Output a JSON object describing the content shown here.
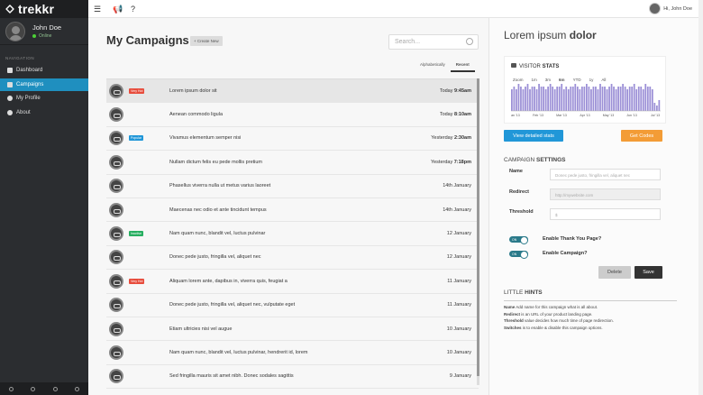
{
  "sidebar": {
    "logo": "trekkr",
    "user": {
      "name": "John Doe",
      "status": "Online"
    },
    "nav_label": "NAVIGATION",
    "items": [
      {
        "label": "Dashboard",
        "icon": "home-icon"
      },
      {
        "label": "Campaigns",
        "icon": "megaphone-icon"
      },
      {
        "label": "My Profile",
        "icon": "user-icon"
      },
      {
        "label": "About",
        "icon": "info-icon"
      }
    ]
  },
  "topbar": {
    "greeting": "Hi, John Doe"
  },
  "main": {
    "title": "My Campaigns",
    "create_label": "+ Create New",
    "search_placeholder": "Search...",
    "tabs": [
      "Alphabetically",
      "Recent"
    ],
    "campaigns": [
      {
        "name": "Lorem ipsum dolor sit",
        "badge": "Very Hot",
        "badge_color": "#e74c3c",
        "day": "Today",
        "time": "9:45am",
        "selected": true
      },
      {
        "name": "Aenean commodo ligula",
        "badge": "",
        "day": "Today",
        "time": "8:10am"
      },
      {
        "name": "Vivamus elementum semper nisi",
        "badge": "Popular",
        "badge_color": "#2197d8",
        "day": "Yesterday",
        "time": "2:30am"
      },
      {
        "name": "Nullam dictum felis eu pede mollis pretium",
        "badge": "",
        "day": "Yesterday",
        "time": "7:18pm"
      },
      {
        "name": "Phasellus viverra nulla ut metus varius laoreet",
        "badge": "",
        "day": "14th January",
        "time": ""
      },
      {
        "name": "Maecenas nec odio et ante tincidunt tempus",
        "badge": "",
        "day": "14th January",
        "time": ""
      },
      {
        "name": "Nam quam nunc, blandit vel, luctus pulvinar",
        "badge": "Inactive",
        "badge_color": "#27ae60",
        "day": "12 January",
        "time": ""
      },
      {
        "name": "Donec pede justo, fringilla vel, aliquet nec",
        "badge": "",
        "day": "12 January",
        "time": ""
      },
      {
        "name": "Aliquam lorem ante, dapibus in, viverra quis, feugiat a",
        "badge": "Very Hot",
        "badge_color": "#e74c3c",
        "day": "11 January",
        "time": ""
      },
      {
        "name": "Donec pede justo, fringilla vel, aliquet nec, vulputate eget",
        "badge": "",
        "day": "11 January",
        "time": ""
      },
      {
        "name": "Etiam ultricies nisi vel augue",
        "badge": "",
        "day": "10 January",
        "time": ""
      },
      {
        "name": "Nam quam nunc, blandit vel, luctus pulvinar, hendrerit id, lorem",
        "badge": "",
        "day": "10 January",
        "time": ""
      },
      {
        "name": "Sed fringilla mauris sit amet nibh. Donec sodales sagittis",
        "badge": "",
        "day": "9 January",
        "time": ""
      }
    ]
  },
  "panel": {
    "title_light": "Lorem ipsum",
    "title_bold": "dolor",
    "visitor_light": "VISITOR",
    "visitor_bold": "STATS",
    "zoom_label": "Zoom",
    "zoom_options": [
      "1m",
      "3m",
      "6m",
      "YTD",
      "1y",
      "All"
    ],
    "zoom_selected": "6m",
    "chart_data": {
      "type": "bar",
      "x_labels": [
        "Jan '13",
        "Feb '13",
        "Mar '13",
        "Apr '13",
        "May '13",
        "Jun '13",
        "Jul '13"
      ],
      "values": [
        8,
        9,
        8,
        10,
        9,
        8,
        9,
        10,
        8,
        9,
        9,
        8,
        10,
        9,
        9,
        8,
        9,
        10,
        9,
        8,
        9,
        9,
        10,
        8,
        9,
        8,
        9,
        9,
        10,
        9,
        8,
        9,
        9,
        10,
        9,
        8,
        9,
        9,
        8,
        10,
        9,
        9,
        8,
        9,
        10,
        9,
        8,
        9,
        9,
        10,
        9,
        8,
        9,
        9,
        10,
        8,
        9,
        9,
        8,
        10,
        9,
        9,
        8,
        3,
        2,
        4
      ],
      "bar_color": "#9b8fd6"
    },
    "detailed_label": "View detailed stats",
    "codes_label": "Get Codes",
    "settings_light": "CAMPAIGN",
    "settings_bold": "SETTINGS",
    "name_label": "Name",
    "name_placeholder": "Donec pede justo, fringilla vel, aliquet nec",
    "redirect_label": "Redirect",
    "redirect_placeholder": "http://mywebsite.com",
    "threshold_label": "Threshold",
    "threshold_placeholder": "$",
    "toggle_on": "ON",
    "thank_you_label": "Enable Thank You Page?",
    "campaign_label": "Enable Campaign?",
    "delete_label": "Delete",
    "save_label": "Save",
    "hints_light": "LITTLE",
    "hints_bold": "HINTS",
    "hints": [
      {
        "key": "Name",
        "text": " Add name for this campaign what is all about."
      },
      {
        "key": "Redirect",
        "text": " is an URL of your product landing page."
      },
      {
        "key": "Threshold",
        "text": " value decides how much time of page redirection."
      },
      {
        "key": "Switches",
        "text": " is to enable & disable this campaign options."
      }
    ]
  }
}
